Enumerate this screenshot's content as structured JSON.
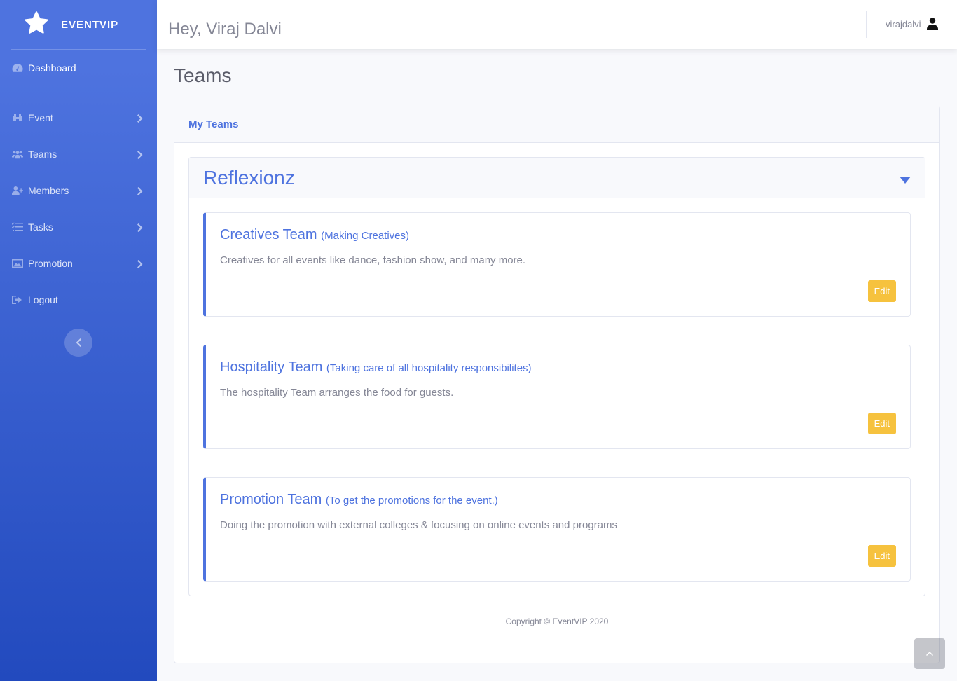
{
  "brand": {
    "name": "EVENTVIP",
    "icon": "star-icon"
  },
  "sidebar": {
    "dashboard": {
      "label": "Dashboard",
      "icon": "tachometer-icon"
    },
    "items": [
      {
        "label": "Event",
        "icon": "binoculars-icon"
      },
      {
        "label": "Teams",
        "icon": "users-icon"
      },
      {
        "label": "Members",
        "icon": "user-plus-icon"
      },
      {
        "label": "Tasks",
        "icon": "tasks-icon"
      },
      {
        "label": "Promotion",
        "icon": "image-icon"
      }
    ],
    "logout": {
      "label": "Logout",
      "icon": "sign-out-icon"
    },
    "toggle_icon": "chevron-left-icon"
  },
  "topbar": {
    "greeting": "Hey, Viraj Dalvi",
    "username": "virajdalvi",
    "user_icon": "user-icon"
  },
  "page": {
    "title": "Teams"
  },
  "card": {
    "header": "My Teams"
  },
  "organization": {
    "name": "Reflexionz",
    "teams": [
      {
        "name": "Creatives Team",
        "subtitle": "(Making Creatives)",
        "description": "Creatives for all events like dance, fashion show, and many more.",
        "edit_label": "Edit"
      },
      {
        "name": "Hospitality Team",
        "subtitle": "(Taking care of all hospitality responsibilites)",
        "description": "The hospitality Team arranges the food for guests.",
        "edit_label": "Edit"
      },
      {
        "name": "Promotion Team",
        "subtitle": "(To get the promotions for the event.)",
        "description": "Doing the promotion with external colleges & focusing on online events and programs",
        "edit_label": "Edit"
      }
    ]
  },
  "footer": {
    "copyright": "Copyright © EventVIP 2020"
  },
  "colors": {
    "primary": "#4e73df",
    "warning": "#f6c23e",
    "text": "#858796"
  }
}
